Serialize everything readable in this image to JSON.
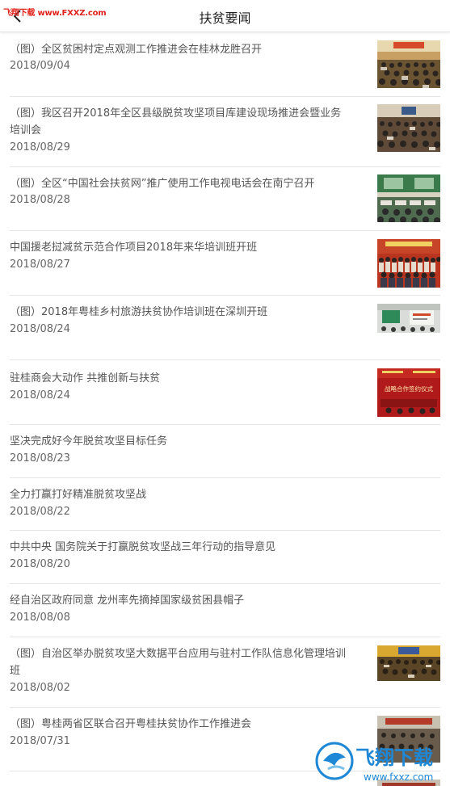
{
  "header": {
    "title": "扶贫要闻",
    "watermark": "飞翔下载 www.FXXZ.com"
  },
  "articles": [
    {
      "title": "（图）全区贫困村定点观测工作推进会在桂林龙胜召开",
      "date": "2018/09/04",
      "thumb": "meeting-hall-photo"
    },
    {
      "title": "（图）我区召开2018年全区县级脱贫攻坚项目库建设现场推进会暨业务培训会",
      "date": "2018/08/29",
      "thumb": "meeting-hall-photo"
    },
    {
      "title": "（图）全区“中国社会扶贫网”推广使用工作电视电话会在南宁召开",
      "date": "2018/08/28",
      "thumb": "meeting-hall-photo"
    },
    {
      "title": "中国援老挝减贫示范合作项目2018年来华培训班开班",
      "date": "2018/08/27",
      "thumb": "group-photo"
    },
    {
      "title": "（图）2018年粤桂乡村旅游扶贫协作培训班在深圳开班",
      "date": "2018/08/24",
      "thumb": "classroom-photo"
    },
    {
      "title": "驻桂商会大动作 共推创新与扶贫",
      "date": "2018/08/24",
      "thumb": "signing-ceremony-photo",
      "thumb_text": "战略合作签约仪式"
    },
    {
      "title": "坚决完成好今年脱贫攻坚目标任务",
      "date": "2018/08/23"
    },
    {
      "title": "全力打赢打好精准脱贫攻坚战",
      "date": "2018/08/22"
    },
    {
      "title": "中共中央 国务院关于打赢脱贫攻坚战三年行动的指导意见",
      "date": "2018/08/20"
    },
    {
      "title": "经自治区政府同意 龙州率先摘掉国家级贫困县帽子",
      "date": "2018/08/08"
    },
    {
      "title": "（图）自治区举办脱贫攻坚大数据平台应用与驻村工作队信息化管理培训班",
      "date": "2018/08/02",
      "thumb": "meeting-hall-photo"
    },
    {
      "title": "（图）粤桂两省区联合召开粤桂扶贫协作工作推进会",
      "date": "2018/07/31",
      "thumb": "meeting-hall-photo"
    }
  ],
  "watermark_bottom": {
    "brand": "飞翔下载",
    "url": "www.fxxz.com"
  },
  "colors": {
    "watermark_red": "#e0221c",
    "watermark_blue": "#1e88d6",
    "divider": "#e5e5e5"
  }
}
